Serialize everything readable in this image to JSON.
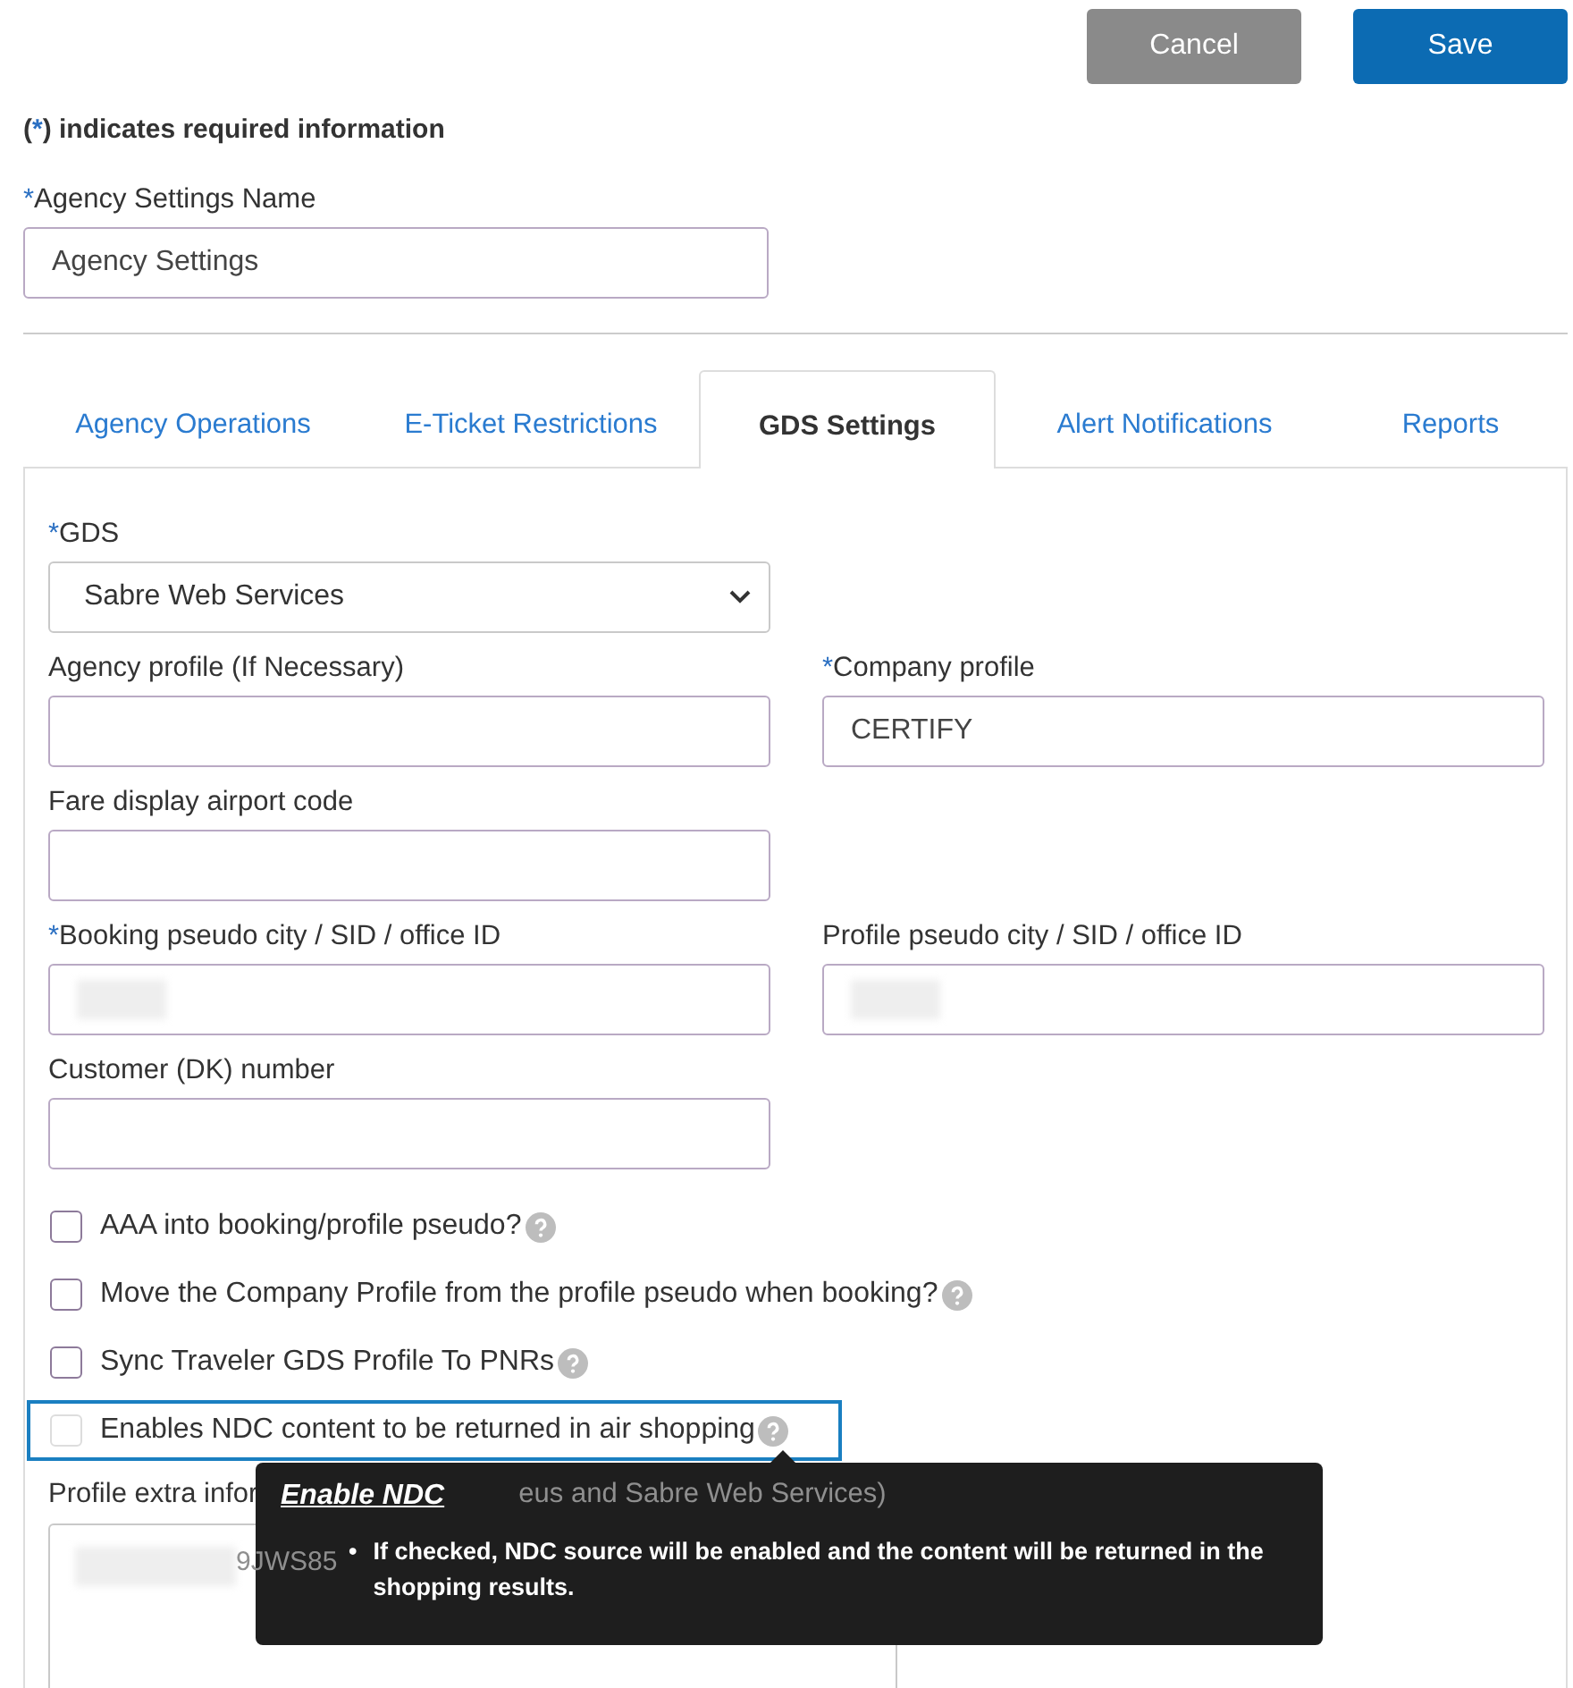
{
  "actions": [
    {
      "kind": "secondary",
      "label": "Cancel"
    },
    {
      "kind": "primary",
      "label": "Save"
    }
  ],
  "legend": {
    "open": "(",
    "mark": "*",
    "text": ") indicates required information"
  },
  "name_field": {
    "mark": "*",
    "label": "Agency Settings Name",
    "value": "Agency Settings"
  },
  "tabs": [
    {
      "label": "Agency Operations",
      "selected": false
    },
    {
      "label": "E-Ticket Restrictions",
      "selected": false
    },
    {
      "label": "GDS Settings",
      "selected": true
    },
    {
      "label": "Alert Notifications",
      "selected": false
    },
    {
      "label": "Reports",
      "selected": false
    }
  ],
  "field_rows": [
    [
      {
        "kind": "select",
        "mark": "*",
        "label": "GDS",
        "value": "Sabre Web Services",
        "redacted": false
      }
    ],
    [
      {
        "kind": "input",
        "label": "Agency profile (If Necessary)",
        "redacted": false
      },
      {
        "kind": "input",
        "mark": "*",
        "label": "Company profile",
        "value": "CERTIFY",
        "redacted": false
      }
    ],
    [
      {
        "kind": "input",
        "label": "Fare display airport code",
        "redacted": false
      }
    ],
    [
      {
        "kind": "input",
        "mark": "*",
        "label": "Booking pseudo city / SID / office ID",
        "redacted": true
      },
      {
        "kind": "input",
        "label": "Profile pseudo city / SID / office ID",
        "redacted": true
      }
    ],
    [
      {
        "kind": "input",
        "label": "Customer (DK) number",
        "redacted": false
      }
    ]
  ],
  "checkboxes": [
    {
      "label": "AAA into booking/profile pseudo?",
      "checked": false,
      "focused": false
    },
    {
      "label": "Move the Company Profile from the profile pseudo when booking?",
      "checked": false,
      "focused": false
    },
    {
      "label": "Sync Traveler GDS Profile To PNRs",
      "checked": false,
      "focused": false
    },
    {
      "label": "Enables NDC content to be returned in air shopping",
      "checked": false,
      "focused": true
    }
  ],
  "extra": {
    "label_start": "Profile extra infor",
    "label_end": "eus and Sabre Web Services)",
    "value": "9JWS85"
  },
  "tooltip": {
    "title": "Enable NDC",
    "items": [
      {
        "bullet": "•",
        "text": "If checked, NDC source will be enabled and the content will be returned in the shopping results."
      }
    ]
  }
}
